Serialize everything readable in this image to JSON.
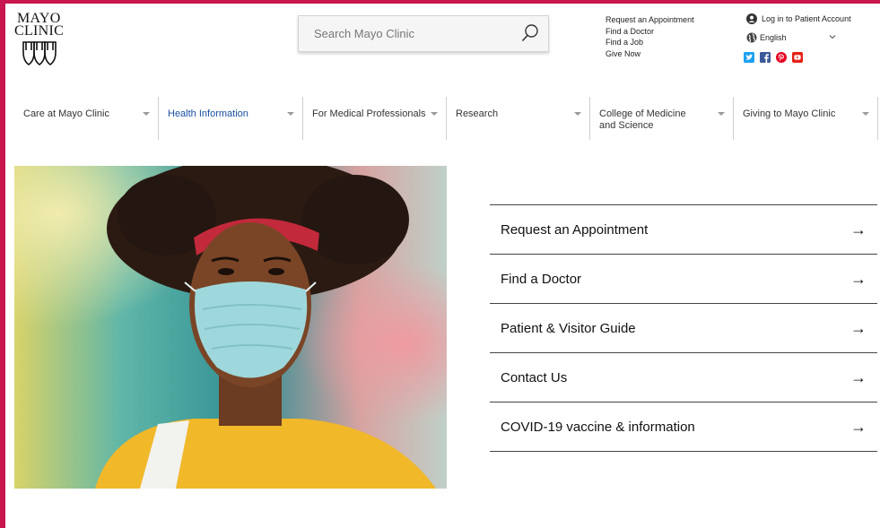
{
  "brand": {
    "logo_line1": "MAYO",
    "logo_line2": "CLINIC",
    "accent_color": "#c8174e",
    "link_color": "#1a4fa3"
  },
  "search": {
    "placeholder": "Search Mayo Clinic",
    "icon": "search-icon"
  },
  "utility_links": [
    "Request an Appointment",
    "Find a Doctor",
    "Find a Job",
    "Give Now"
  ],
  "account": {
    "label": "Log in to Patient Account",
    "icon": "user-icon"
  },
  "language": {
    "selected": "English",
    "icon": "globe-icon"
  },
  "social": [
    {
      "name": "twitter-icon",
      "color": "#1da1f2"
    },
    {
      "name": "facebook-icon",
      "color": "#3b5998"
    },
    {
      "name": "pinterest-icon",
      "color": "#e60023"
    },
    {
      "name": "youtube-icon",
      "color": "#e62117"
    }
  ],
  "nav": [
    {
      "label": "Care at Mayo Clinic",
      "active": false
    },
    {
      "label": "Health Information",
      "active": true
    },
    {
      "label": "For Medical Professionals",
      "active": false
    },
    {
      "label": "Research",
      "active": false
    },
    {
      "label": "College of Medicine and Science",
      "active": false
    },
    {
      "label": "Giving to Mayo Clinic",
      "active": false
    }
  ],
  "actions": [
    {
      "label": "Request an Appointment",
      "arrow": "→"
    },
    {
      "label": "Find a Doctor",
      "arrow": "→"
    },
    {
      "label": "Patient & Visitor Guide",
      "arrow": "→"
    },
    {
      "label": "Contact Us",
      "arrow": "→"
    },
    {
      "label": "COVID-19 vaccine & information",
      "arrow": "→"
    }
  ]
}
